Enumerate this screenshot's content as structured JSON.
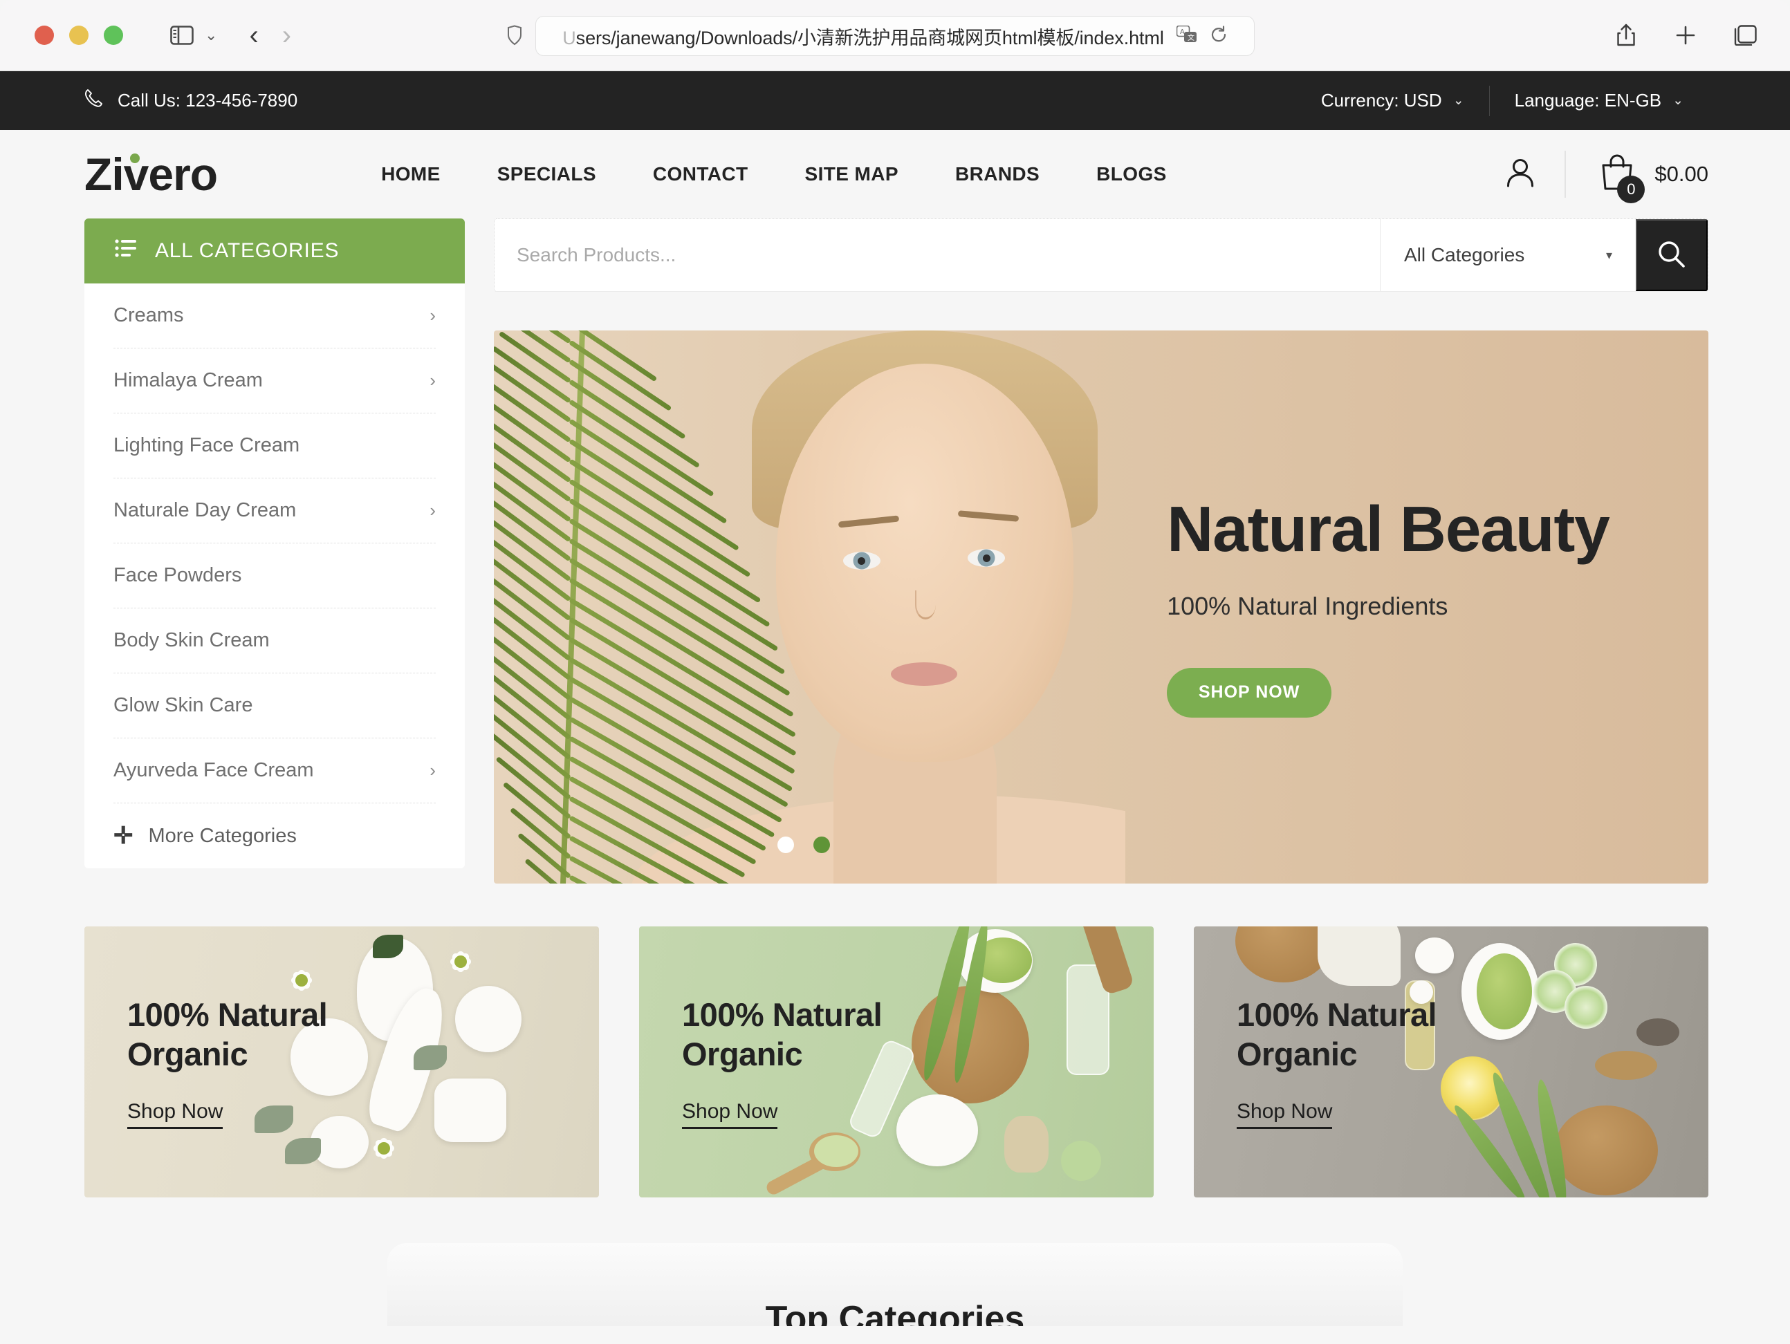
{
  "browser": {
    "url_faded": "U",
    "url": "sers/janewang/Downloads/小清新洗护用品商城网页html模板/index.html",
    "icons": {
      "sidebar": "sidebar-icon",
      "tab_overview": "tab-overview-icon",
      "back": "back-arrow-icon",
      "forward": "forward-arrow-icon",
      "shield": "shield-icon",
      "translate": "translate-icon",
      "reload": "reload-icon",
      "share": "share-icon",
      "new_tab": "plus-icon",
      "tabs": "tabs-icon"
    }
  },
  "topbar": {
    "phone_icon": "phone-icon",
    "phone": "Call Us: 123-456-7890",
    "currency": "Currency: USD",
    "language": "Language: EN-GB",
    "caret": "⌄"
  },
  "header": {
    "logo": "Zivero",
    "nav": [
      {
        "label": "HOME"
      },
      {
        "label": "SPECIALS"
      },
      {
        "label": "CONTACT"
      },
      {
        "label": "SITE MAP"
      },
      {
        "label": "BRANDS"
      },
      {
        "label": "BLOGS"
      }
    ],
    "cart_count": "0",
    "cart_total": "$0.00"
  },
  "sidebar": {
    "title": "ALL CATEGORIES",
    "items": [
      {
        "label": "Creams",
        "arrow": "›"
      },
      {
        "label": "Himalaya Cream",
        "arrow": "›"
      },
      {
        "label": "Lighting Face Cream",
        "arrow": ""
      },
      {
        "label": "Naturale Day Cream",
        "arrow": "›"
      },
      {
        "label": "Face Powders",
        "arrow": ""
      },
      {
        "label": "Body Skin Cream",
        "arrow": ""
      },
      {
        "label": "Glow Skin Care",
        "arrow": ""
      },
      {
        "label": "Ayurveda Face Cream",
        "arrow": "›"
      }
    ],
    "more": "More Categories",
    "more_plus": "✛"
  },
  "search": {
    "placeholder": "Search Products...",
    "value": "",
    "category": "All Categories",
    "caret": "▾"
  },
  "hero": {
    "title": "Natural Beauty",
    "subtitle": "100% Natural Ingredients",
    "cta": "SHOP NOW",
    "slides": 2,
    "active_slide": 2
  },
  "promos": [
    {
      "title_line1": "100% Natural",
      "title_line2": "Organic",
      "link": "Shop Now"
    },
    {
      "title_line1": "100% Natural",
      "title_line2": "Organic",
      "link": "Shop Now"
    },
    {
      "title_line1": "100% Natural",
      "title_line2": "Organic",
      "link": "Shop Now"
    }
  ],
  "bottom": {
    "title": "Top Categories"
  },
  "colors": {
    "accent_green": "#7cab4f",
    "dark": "#232323",
    "hero_bg": "#d8bb9c",
    "promo1_bg": "#e3ddca",
    "promo2_bg": "#bdd3a7",
    "promo3_bg": "#a7a39b"
  }
}
